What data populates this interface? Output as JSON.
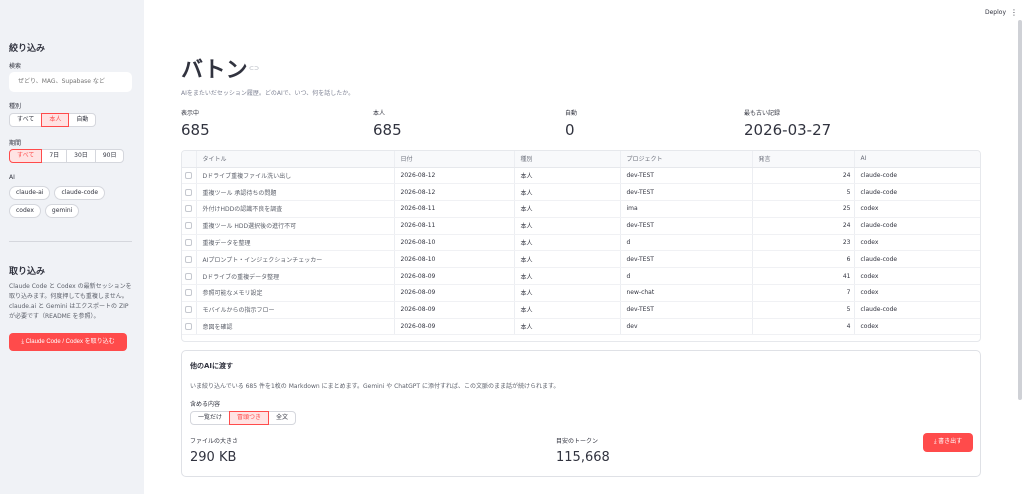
{
  "header": {
    "deploy_label": "Deploy",
    "menu_icon": "kebab-menu-icon"
  },
  "sidebar": {
    "filter_heading": "絞り込み",
    "search_label": "検索",
    "search_placeholder": "ぜどり、MAG、Supabase など",
    "type_label": "種別",
    "type_options": [
      "すべて",
      "本人",
      "自動"
    ],
    "type_selected": "本人",
    "period_label": "期間",
    "period_options": [
      "すべて",
      "7日",
      "30日",
      "90日"
    ],
    "period_selected": "すべて",
    "ai_label": "AI",
    "ai_options": [
      "claude-ai",
      "claude-code",
      "codex",
      "gemini"
    ],
    "import_heading": "取り込み",
    "import_text": "Claude Code と Codex の最新セッションを取り込みます。何度押しても重複しません。claude.ai と Gemini はエクスポートの ZIP が必要です（README を参照）。",
    "import_button": "Claude Code / Codex を取り込む"
  },
  "main": {
    "title": "バトン",
    "subtitle": "AIをまたいだセッション履歴。どのAIで、いつ、何を話したか。",
    "metrics": [
      {
        "label": "表示中",
        "value": "685"
      },
      {
        "label": "本人",
        "value": "685"
      },
      {
        "label": "自動",
        "value": "0"
      },
      {
        "label": "最も古い記録",
        "value": "2026-03-27"
      }
    ]
  },
  "table": {
    "columns": [
      "タイトル",
      "日付",
      "種別",
      "プロジェクト",
      "発言",
      "AI"
    ],
    "rows": [
      [
        "Dドライブ重複ファイル洗い出し",
        "2026-08-12",
        "本人",
        "dev-TEST",
        "24",
        "claude-code"
      ],
      [
        "重複ツール 承認待ちの問題",
        "2026-08-12",
        "本人",
        "dev-TEST",
        "5",
        "claude-code"
      ],
      [
        "外付けHDDの認識不良を調査",
        "2026-08-11",
        "本人",
        "ima",
        "25",
        "codex"
      ],
      [
        "重複ツール HDD選択後の進行不可",
        "2026-08-11",
        "本人",
        "dev-TEST",
        "24",
        "claude-code"
      ],
      [
        "重複データを整理",
        "2026-08-10",
        "本人",
        "d",
        "23",
        "codex"
      ],
      [
        "AIプロンプト・インジェクションチェッカー",
        "2026-08-10",
        "本人",
        "dev-TEST",
        "6",
        "claude-code"
      ],
      [
        "Dドライブの重複データ整理",
        "2026-08-09",
        "本人",
        "d",
        "41",
        "codex"
      ],
      [
        "参照可能なメモリ設定",
        "2026-08-09",
        "本人",
        "new-chat",
        "7",
        "codex"
      ],
      [
        "モバイルからの指示フロー",
        "2026-08-09",
        "本人",
        "dev-TEST",
        "5",
        "claude-code"
      ],
      [
        "意図を確認",
        "2026-08-09",
        "本人",
        "dev",
        "4",
        "codex"
      ]
    ]
  },
  "handoff": {
    "heading": "他のAIに渡す",
    "description": "いま絞り込んでいる 685 件を1枚の Markdown にまとめます。Gemini や ChatGPT に添付すれば、この文脈のまま話が続けられます。",
    "include_label": "含める内容",
    "include_options": [
      "一覧だけ",
      "冒頭つき",
      "全文"
    ],
    "include_selected": "冒頭つき",
    "file_size_label": "ファイルの大きさ",
    "file_size_value": "290 KB",
    "token_label": "目安のトークン",
    "token_value": "115,668",
    "export_button": "書き出す"
  }
}
